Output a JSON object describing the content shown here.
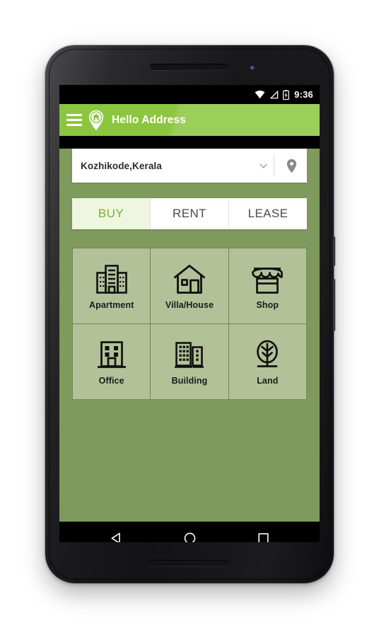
{
  "status_bar": {
    "time": "9:36",
    "icons": [
      "wifi-icon",
      "cell-signal-icon",
      "battery-charging-icon"
    ]
  },
  "app_bar": {
    "menu_icon": "hamburger-menu-icon",
    "logo_icon": "home-pin-logo-icon",
    "title": "Hello Address",
    "background_color": "#8cc63f"
  },
  "location_search": {
    "value": "Kozhikode,Kerala",
    "dropdown_icon": "chevron-down-icon",
    "pin_icon": "map-pin-icon"
  },
  "tabs": [
    {
      "label": "BUY",
      "active": true
    },
    {
      "label": "RENT",
      "active": false
    },
    {
      "label": "LEASE",
      "active": false
    }
  ],
  "categories": [
    {
      "label": "Apartment",
      "icon": "apartment-icon"
    },
    {
      "label": "Villa/House",
      "icon": "house-icon"
    },
    {
      "label": "Shop",
      "icon": "shop-icon"
    },
    {
      "label": "Office",
      "icon": "office-icon"
    },
    {
      "label": "Building",
      "icon": "building-icon"
    },
    {
      "label": "Land",
      "icon": "tree-icon"
    }
  ],
  "nav_bar": {
    "back_label": "back-icon",
    "home_label": "home-icon",
    "recents_label": "recents-icon"
  },
  "colors": {
    "app_bar_green": "#8cc63f",
    "page_background": "#7f9a5d",
    "tile_background": "#b3c198",
    "active_tab_background": "#eef6e0",
    "active_tab_text": "#7ab033"
  }
}
